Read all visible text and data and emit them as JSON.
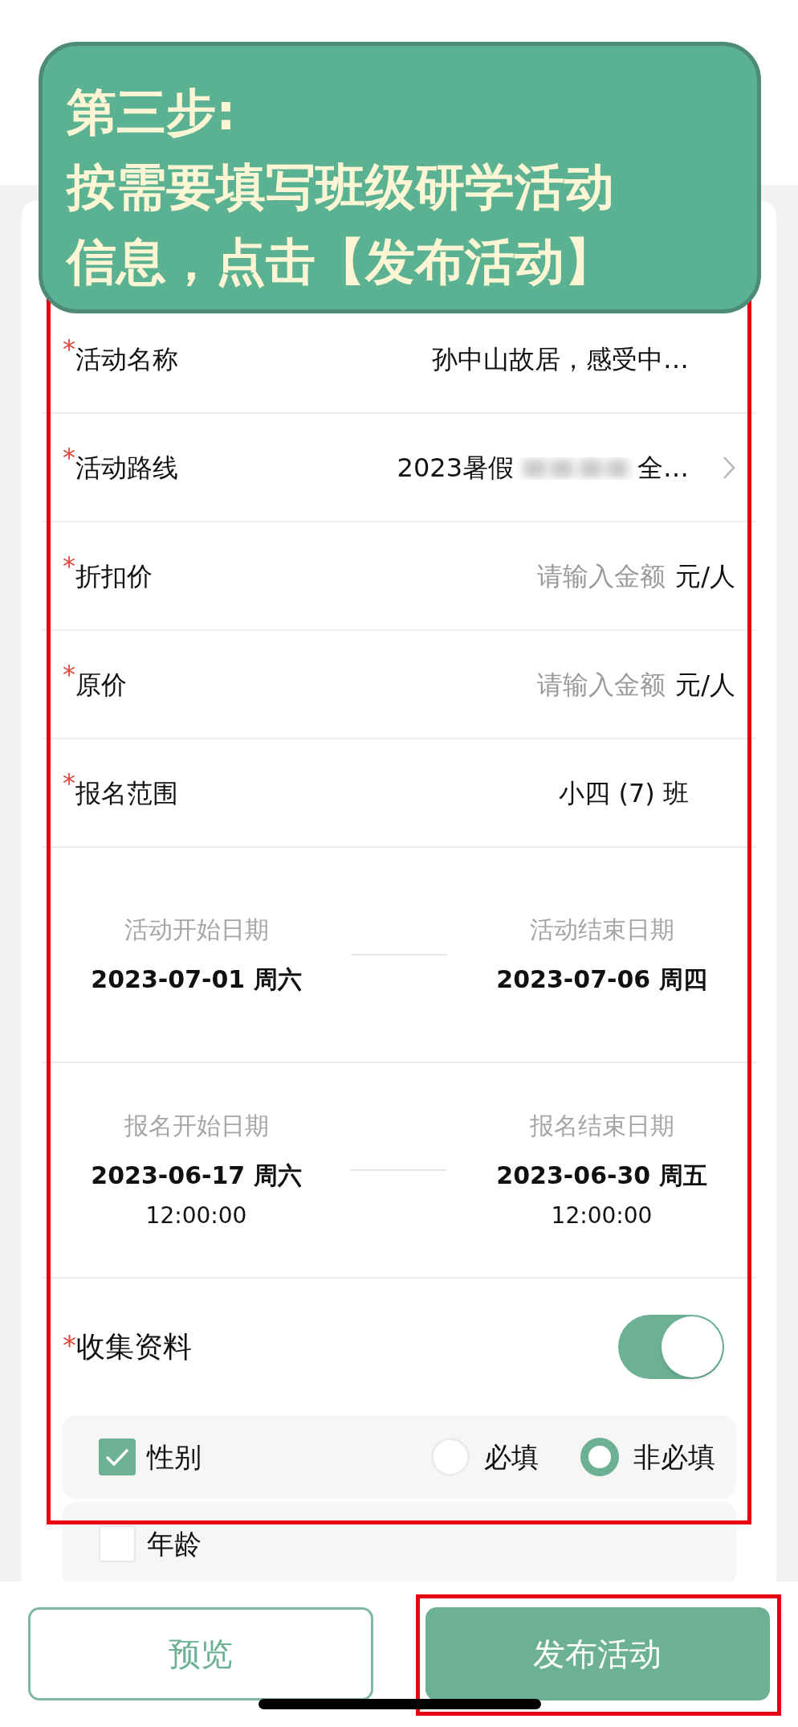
{
  "tooltip": {
    "lines": [
      "第三步:",
      "按需要填写班级研学活动",
      "信息，点击【发布活动】"
    ]
  },
  "form": {
    "highlighted": true,
    "rows": [
      {
        "kind": "text",
        "required_mark": "*",
        "label": "活动名称",
        "value": "孙中山故居，感受中…"
      },
      {
        "kind": "link",
        "required_mark": "*",
        "label": "活动路线",
        "value": "2023暑假",
        "redacted": true,
        "value_end": "全…"
      },
      {
        "kind": "amount",
        "required_mark": "*",
        "label": "折扣价",
        "placeholder": "请输入金额",
        "unit": "元/人"
      },
      {
        "kind": "amount",
        "required_mark": "*",
        "label": "原价",
        "placeholder": "请输入金额",
        "unit": "元/人"
      },
      {
        "kind": "text",
        "required_mark": "*",
        "label": "报名范围",
        "value": "小四 (7) 班"
      }
    ],
    "date_ranges": [
      {
        "start_label": "活动开始日期",
        "start_date": "2023-07-01 周六",
        "end_label": "活动结束日期",
        "end_date": "2023-07-06 周四"
      },
      {
        "start_label": "报名开始日期",
        "start_date": "2023-06-17 周六",
        "start_time": "12:00:00",
        "end_label": "报名结束日期",
        "end_date": "2023-06-30 周五",
        "end_time": "12:00:00"
      }
    ],
    "collect": {
      "required_mark": "*",
      "label": "收集资料",
      "on": true,
      "fields": [
        {
          "label": "性别",
          "checked": true,
          "options": [
            {
              "label": "必填",
              "selected": false
            },
            {
              "label": "非必填",
              "selected": true
            }
          ]
        },
        {
          "label": "年龄",
          "checked": false
        }
      ]
    }
  },
  "buttons": [
    {
      "kind": "outline",
      "label": "预览",
      "highlighted": false
    },
    {
      "kind": "primary",
      "label": "发布活动",
      "highlighted": true
    }
  ]
}
